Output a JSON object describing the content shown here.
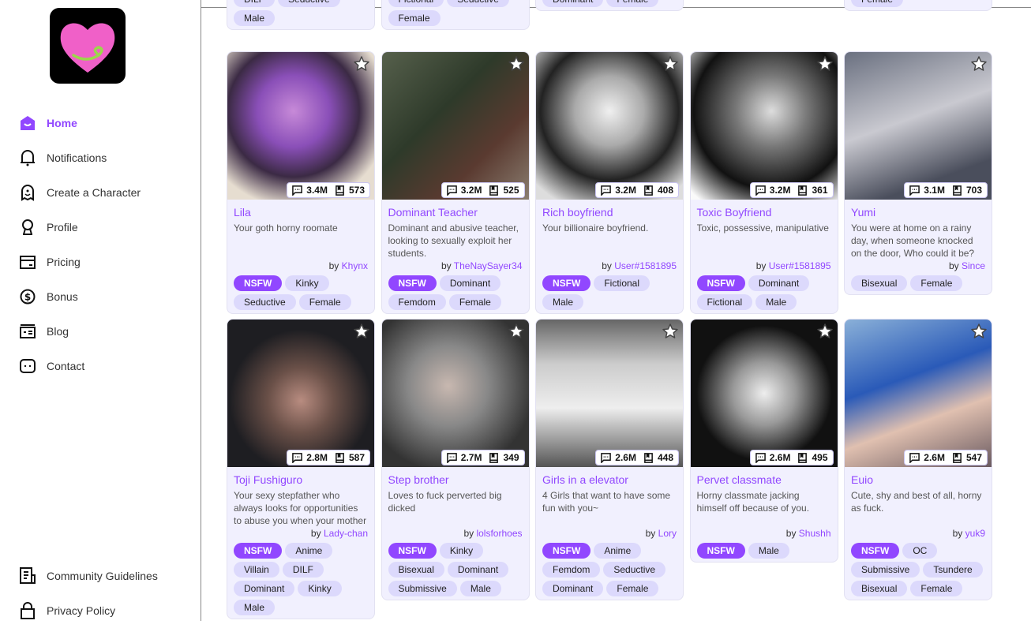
{
  "sidebar": {
    "items": [
      {
        "label": "Home",
        "icon": "home-icon",
        "active": true
      },
      {
        "label": "Notifications",
        "icon": "bell-icon"
      },
      {
        "label": "Create a Character",
        "icon": "ghost-icon"
      },
      {
        "label": "Profile",
        "icon": "profile-icon"
      },
      {
        "label": "Pricing",
        "icon": "card-icon"
      },
      {
        "label": "Bonus",
        "icon": "dollar-icon"
      },
      {
        "label": "Blog",
        "icon": "blog-icon"
      },
      {
        "label": "Contact",
        "icon": "chat-icon"
      }
    ],
    "bottom": [
      {
        "label": "Community Guidelines",
        "icon": "guidelines-icon"
      },
      {
        "label": "Privacy Policy",
        "icon": "lock-icon"
      }
    ]
  },
  "colors": {
    "accent": "#9147ff",
    "card_bg": "#f1f0fe",
    "tag_bg": "#dcd9fc"
  },
  "partial_row": [
    {
      "tags": [
        "DILF",
        "Seductive",
        "Male"
      ]
    },
    {
      "tags": [
        "Fictional",
        "Seductive",
        "Female"
      ]
    },
    {
      "tags": [
        "Dominant",
        "Female"
      ]
    },
    {
      "tags": []
    },
    {
      "tags": [
        "Female"
      ]
    }
  ],
  "cards": [
    {
      "title": "Lila",
      "desc": "Your goth horny roomate",
      "by": "by",
      "author": "Khynx",
      "chats": "3.4M",
      "msgs": "573",
      "tags": [
        "NSFW",
        "Kinky",
        "Seductive",
        "Female"
      ]
    },
    {
      "title": "Dominant Teacher",
      "desc": "Dominant and abusive teacher, looking to sexually exploit her students.",
      "by": "by",
      "author": "TheNaySayer34",
      "chats": "3.2M",
      "msgs": "525",
      "tags": [
        "NSFW",
        "Dominant",
        "Femdom",
        "Female"
      ]
    },
    {
      "title": "Rich boyfriend",
      "desc": "Your billionaire boyfriend.",
      "by": "by",
      "author": "User#1581895",
      "chats": "3.2M",
      "msgs": "408",
      "tags": [
        "NSFW",
        "Fictional",
        "Male"
      ]
    },
    {
      "title": "Toxic Boyfriend",
      "desc": "Toxic, possessive, manipulative",
      "by": "by",
      "author": "User#1581895",
      "chats": "3.2M",
      "msgs": "361",
      "tags": [
        "NSFW",
        "Dominant",
        "Fictional",
        "Male"
      ]
    },
    {
      "title": "Yumi",
      "desc": "You were at home on a rainy day, when someone knocked on the door, Who could it be?",
      "by": "by",
      "author": "Since",
      "chats": "3.1M",
      "msgs": "703",
      "tags": [
        "Bisexual",
        "Female"
      ]
    },
    {
      "title": "Toji Fushiguro",
      "desc": "Your sexy stepfather who always looks for opportunities to abuse you when your mother is",
      "by": "by",
      "author": "Lady-chan",
      "chats": "2.8M",
      "msgs": "587",
      "tags": [
        "NSFW",
        "Anime",
        "Villain",
        "DILF",
        "Dominant",
        "Kinky",
        "Male"
      ]
    },
    {
      "title": "Step brother",
      "desc": "Loves to fuck perverted big dicked",
      "by": "by",
      "author": "lolsforhoes",
      "chats": "2.7M",
      "msgs": "349",
      "tags": [
        "NSFW",
        "Kinky",
        "Bisexual",
        "Dominant",
        "Submissive",
        "Male"
      ]
    },
    {
      "title": "Girls in a elevator",
      "desc": "4 Girls that want to have some fun with you~",
      "by": "by",
      "author": "Lory",
      "chats": "2.6M",
      "msgs": "448",
      "tags": [
        "NSFW",
        "Anime",
        "Femdom",
        "Seductive",
        "Dominant",
        "Female"
      ]
    },
    {
      "title": "Pervet classmate",
      "desc": "Horny classmate jacking himself off because of you.",
      "by": "by",
      "author": "Shushh",
      "chats": "2.6M",
      "msgs": "495",
      "tags": [
        "NSFW",
        "Male"
      ]
    },
    {
      "title": "Euio",
      "desc": "Cute, shy and best of all, horny as fuck.",
      "by": "by",
      "author": "yuk9",
      "chats": "2.6M",
      "msgs": "547",
      "tags": [
        "NSFW",
        "OC",
        "Submissive",
        "Tsundere",
        "Bisexual",
        "Female"
      ]
    }
  ]
}
